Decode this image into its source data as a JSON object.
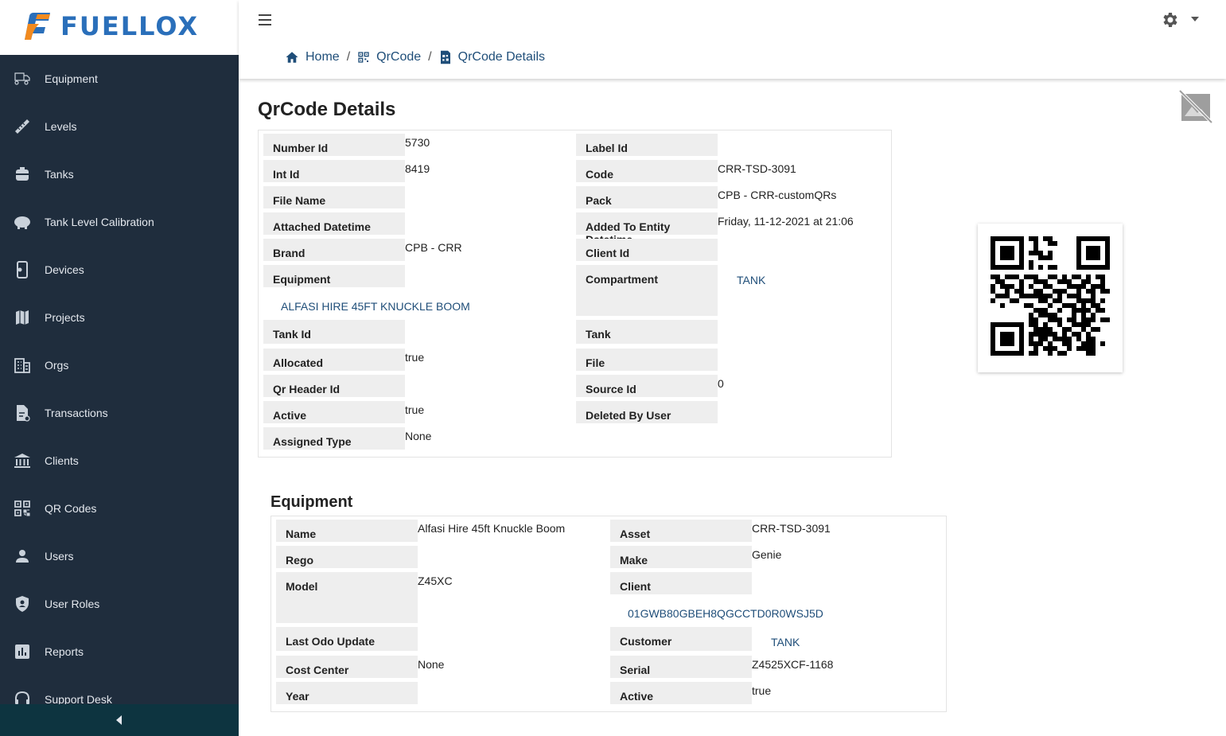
{
  "brand": {
    "name": "FUELLOX"
  },
  "sidebar": {
    "items": [
      {
        "label": "Equipment",
        "icon": "truck-icon"
      },
      {
        "label": "Levels",
        "icon": "ruler-icon"
      },
      {
        "label": "Tanks",
        "icon": "tank-icon"
      },
      {
        "label": "Tank Level Calibration",
        "icon": "calibration-icon"
      },
      {
        "label": "Devices",
        "icon": "device-icon"
      },
      {
        "label": "Projects",
        "icon": "map-icon"
      },
      {
        "label": "Orgs",
        "icon": "building-icon"
      },
      {
        "label": "Transactions",
        "icon": "receipt-icon"
      },
      {
        "label": "Clients",
        "icon": "bank-icon"
      },
      {
        "label": "QR Codes",
        "icon": "qr-icon"
      },
      {
        "label": "Users",
        "icon": "user-icon"
      },
      {
        "label": "User Roles",
        "icon": "shield-icon"
      },
      {
        "label": "Reports",
        "icon": "chart-icon"
      },
      {
        "label": "Support Desk",
        "icon": "headset-icon"
      }
    ]
  },
  "breadcrumb": [
    {
      "label": "Home"
    },
    {
      "label": "QrCode"
    },
    {
      "label": "QrCode Details"
    }
  ],
  "page": {
    "title": "QrCode Details"
  },
  "details": {
    "left": [
      {
        "label": "Number Id",
        "value": "5730"
      },
      {
        "label": "Int Id",
        "value": "8419"
      },
      {
        "label": "File Name",
        "value": ""
      },
      {
        "label": "Attached Datetime",
        "value": ""
      },
      {
        "label": "Brand",
        "value": "CPB - CRR"
      },
      {
        "label": "Equipment",
        "value": "",
        "link": "ALFASI HIRE 45FT KNUCKLE BOOM"
      },
      {
        "label": "Tank Id",
        "value": ""
      },
      {
        "label": "Allocated",
        "value": "true"
      },
      {
        "label": "Qr Header Id",
        "value": ""
      },
      {
        "label": "Active",
        "value": "true"
      },
      {
        "label": "Assigned Type",
        "value": "None"
      }
    ],
    "right": [
      {
        "label": "Label Id",
        "value": ""
      },
      {
        "label": "Code",
        "value": "CRR-TSD-3091"
      },
      {
        "label": "Pack",
        "value": "CPB - CRR-customQRs"
      },
      {
        "label": "Added To Entity Datetime",
        "value": "Friday, 11-12-2021 at 21:06"
      },
      {
        "label": "Client Id",
        "value": ""
      },
      {
        "label": "Compartment",
        "value": "",
        "link": "TANK"
      },
      {
        "label": "Tank",
        "value": ""
      },
      {
        "label": "File",
        "value": ""
      },
      {
        "label": "Source Id",
        "value": "0"
      },
      {
        "label": "Deleted By User",
        "value": ""
      }
    ]
  },
  "equipment": {
    "title": "Equipment",
    "left": [
      {
        "label": "Name",
        "value": "Alfasi Hire 45ft Knuckle Boom"
      },
      {
        "label": "Rego",
        "value": ""
      },
      {
        "label": "Model",
        "value": "Z45XC"
      },
      {
        "label": "Last Odo Update",
        "value": ""
      },
      {
        "label": "Cost Center",
        "value": "None"
      },
      {
        "label": "Year",
        "value": ""
      }
    ],
    "right": [
      {
        "label": "Asset",
        "value": "CRR-TSD-3091"
      },
      {
        "label": "Make",
        "value": "Genie"
      },
      {
        "label": "Client",
        "value": "",
        "link": "01GWB80GBEH8QGCCTD0R0WSJ5D"
      },
      {
        "label": "Customer",
        "value": "",
        "link": "TANK"
      },
      {
        "label": "Serial",
        "value": "Z4525XCF-1168"
      },
      {
        "label": "Active",
        "value": "true"
      }
    ]
  },
  "colors": {
    "sidebar_bg": "#1f2d3d",
    "link": "#1f4e79",
    "label_bg": "#eeeeee"
  }
}
